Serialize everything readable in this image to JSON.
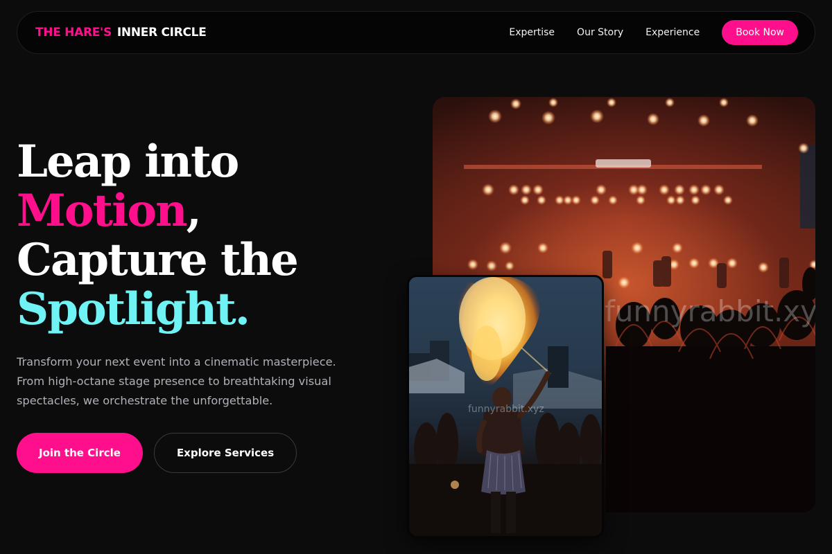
{
  "nav": {
    "logo_part1": "THE HARE'S",
    "logo_part2": "INNER CIRCLE",
    "links": [
      "Expertise",
      "Our Story",
      "Experience"
    ],
    "cta": "Book Now"
  },
  "hero": {
    "line1": "Leap into",
    "line2_highlight": "Motion",
    "line2_rest": ",",
    "line3": "Capture the",
    "line4_highlight": "Spotlight.",
    "subtitle": "Transform your next event into a cinematic masterpiece. From high-octane stage presence to breathtaking visual spectacles, we orchestrate the unforgettable.",
    "primary_cta": "Join the Circle",
    "secondary_cta": "Explore Services"
  },
  "images": {
    "concert_watermark": "funnyrabbit.xyz",
    "fire_watermark": "funnyrabbit.xyz"
  },
  "colors": {
    "background": "#0c0c0d",
    "accent_pink": "#ff0f8c",
    "accent_cyan": "#6ff3f4"
  }
}
